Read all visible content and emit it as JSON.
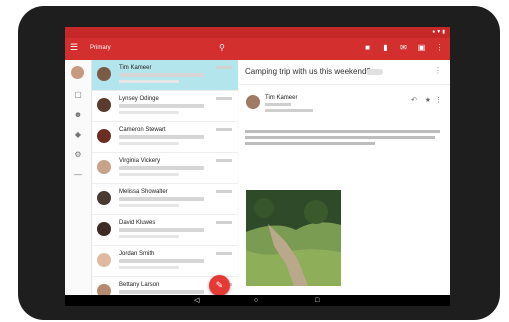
{
  "header": {
    "inbox_label": "Primary"
  },
  "threads": [
    {
      "name": "Tim Kameer",
      "avatar_color": "#7b5a46",
      "selected": true
    },
    {
      "name": "Lynsey Odinge",
      "avatar_color": "#5a3b2e",
      "selected": false
    },
    {
      "name": "Cameron Stewart",
      "avatar_color": "#6b2f22",
      "selected": false
    },
    {
      "name": "Virginia Vickery",
      "avatar_color": "#c9a28a",
      "selected": false
    },
    {
      "name": "Melissa Showalter",
      "avatar_color": "#4a3a30",
      "selected": false
    },
    {
      "name": "David Kluwes",
      "avatar_color": "#3d2a22",
      "selected": false
    },
    {
      "name": "Jordan Smith",
      "avatar_color": "#e0b9a2",
      "selected": false
    },
    {
      "name": "Bettany Larson",
      "avatar_color": "#b48a70",
      "selected": false
    }
  ],
  "email": {
    "subject": "Camping trip with us this weekend?",
    "sender": "Tim Kameer"
  },
  "colors": {
    "app_bar": "#d32f2f",
    "status_bar": "#c62828",
    "fab": "#e53935",
    "selected_row": "#b3e5ec"
  },
  "icons": {
    "menu": "menu-icon",
    "search": "search-icon",
    "compose": "pencil-icon",
    "reply": "reply-icon"
  }
}
